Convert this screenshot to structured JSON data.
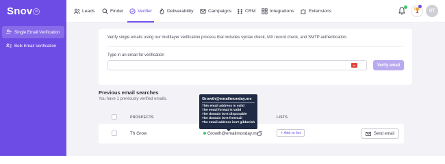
{
  "app": {
    "logo": "Snov",
    "logo_suffix": "io",
    "brand_color": "#6d4ce5"
  },
  "sidebar": {
    "items": [
      {
        "label": "Single Email Verification",
        "icon": "user-check-icon",
        "active": true
      },
      {
        "label": "Bulk Email Verification",
        "icon": "users-list-icon",
        "active": false
      }
    ]
  },
  "nav": {
    "items": [
      {
        "label": "Leads",
        "icon": "users-icon"
      },
      {
        "label": "Finder",
        "icon": "search-icon"
      },
      {
        "label": "Verifier",
        "icon": "check-circle-icon",
        "active": true
      },
      {
        "label": "Deliverability",
        "icon": "flame-icon"
      },
      {
        "label": "Campaigns",
        "icon": "envelope-icon"
      },
      {
        "label": "CRM",
        "icon": "crm-icon"
      },
      {
        "label": "Integrations",
        "icon": "grid-icon"
      },
      {
        "label": "Extensions",
        "icon": "puzzle-icon"
      }
    ],
    "avatar_initials": "GT"
  },
  "verify_card": {
    "intro": "Verify single emails using our multilayer verification process that includes syntax check, MX record check, and SMTP authentication.",
    "field_label": "Type in an email for verification",
    "input_value": "",
    "button_label": "Verify email"
  },
  "previous": {
    "title": "Previous email searches",
    "subtitle": "You have 1 previously verified emails.",
    "columns": [
      "PROSPECTS",
      "LISTS"
    ],
    "rows": [
      {
        "prospect": "Th Grow",
        "email": "Growth@emailmonday.me",
        "status_color": "#3cc46a",
        "add_list_label": "+ Add to list",
        "send_label": "Send email"
      }
    ]
  },
  "tooltip": {
    "title": "Growth@emailmonday.me",
    "checks": [
      "This email address is valid",
      "The email format is valid",
      "The domain isn't disposable",
      "The domain isn't freemail",
      "The email address isn't gibberish"
    ]
  }
}
